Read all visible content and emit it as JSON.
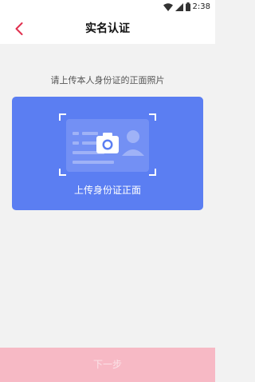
{
  "status_bar": {
    "time": "2:38",
    "icons": [
      "wifi-icon",
      "signal-icon",
      "battery-icon"
    ]
  },
  "header": {
    "title": "实名认证",
    "back_icon": "chevron-left-icon"
  },
  "main": {
    "instruction": "请上传本人身份证的正面照片",
    "upload_card": {
      "label": "上传身份证正面",
      "icon": "camera-icon"
    }
  },
  "footer": {
    "next_label": "下一步"
  },
  "colors": {
    "accent": "#e0304e",
    "card": "#5b7ef2",
    "button": "#f7b9c5"
  }
}
